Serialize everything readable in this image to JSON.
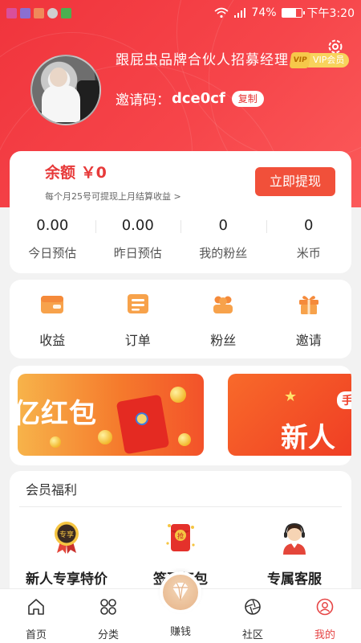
{
  "status_bar": {
    "battery_percent": "74%",
    "battery_level": 0.74,
    "time": "下午3:20"
  },
  "profile": {
    "name": "跟屁虫品牌合伙人招募经理",
    "invite_label": "邀请码：",
    "invite_code": "dce0cf",
    "copy_label": "复制",
    "vip_mark": "VIP",
    "vip_label": "VIP会员"
  },
  "balance": {
    "label": "余额 ￥0",
    "note": "每个月25号可提现上月结算收益 >",
    "withdraw_label": "立即提现",
    "stats": [
      {
        "value": "0.00",
        "label": "今日预估"
      },
      {
        "value": "0.00",
        "label": "昨日预估"
      },
      {
        "value": "0",
        "label": "我的粉丝"
      },
      {
        "value": "0",
        "label": "米币"
      }
    ]
  },
  "menu": [
    {
      "label": "收益",
      "icon": "wallet-icon"
    },
    {
      "label": "订单",
      "icon": "order-icon"
    },
    {
      "label": "粉丝",
      "icon": "fans-icon"
    },
    {
      "label": "邀请",
      "icon": "gift-icon"
    }
  ],
  "banners": [
    {
      "text": "亿红包"
    },
    {
      "tag": "手",
      "text": "新人"
    }
  ],
  "benefits": {
    "title": "会员福利",
    "items": [
      {
        "label": "新人专享特价",
        "badge": "专享",
        "icon": "medal-icon"
      },
      {
        "label": "签到红包",
        "badge": "抢",
        "icon": "red-packet-icon"
      },
      {
        "label": "专属客服",
        "icon": "customer-service-icon"
      }
    ]
  },
  "bottom_nav": {
    "items": [
      {
        "label": "首页",
        "icon": "home-icon"
      },
      {
        "label": "分类",
        "icon": "category-icon"
      },
      {
        "label": "赚钱",
        "icon": "diamond-icon"
      },
      {
        "label": "社区",
        "icon": "camera-aperture-icon"
      },
      {
        "label": "我的",
        "icon": "user-icon"
      }
    ],
    "active_index": 4
  },
  "colors": {
    "primary": "#f0343c",
    "accent_button": "#f1503a",
    "vip_gold": "#f8d35c",
    "active_nav": "#e64545"
  }
}
